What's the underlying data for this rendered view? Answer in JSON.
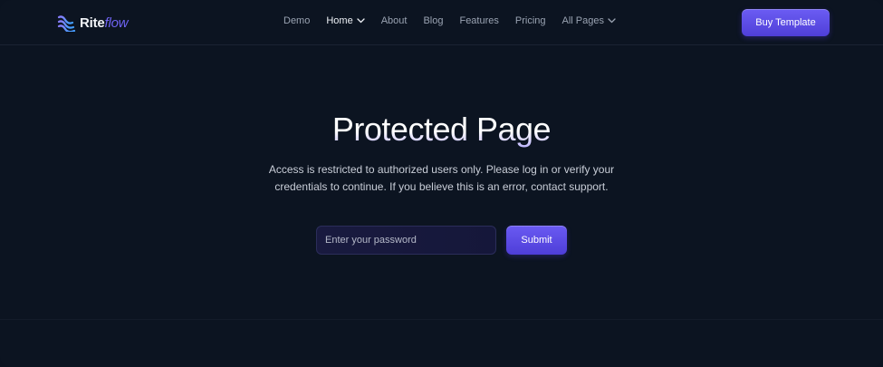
{
  "brand": {
    "name_main": "Rite",
    "name_accent": "flow",
    "accent_color": "#6e63f2"
  },
  "nav": {
    "items": [
      {
        "label": "Demo",
        "dropdown": false,
        "active": false
      },
      {
        "label": "Home",
        "dropdown": true,
        "active": true
      },
      {
        "label": "About",
        "dropdown": false,
        "active": false
      },
      {
        "label": "Blog",
        "dropdown": false,
        "active": false
      },
      {
        "label": "Features",
        "dropdown": false,
        "active": false
      },
      {
        "label": "Pricing",
        "dropdown": false,
        "active": false
      },
      {
        "label": "All Pages",
        "dropdown": true,
        "active": false
      }
    ],
    "cta_label": "Buy Template"
  },
  "hero": {
    "title": "Protected Page",
    "description_line1": "Access is restricted to authorized users only. Please log in or verify your",
    "description_line2": "credentials to continue. If you believe this is an error, contact support."
  },
  "form": {
    "password_placeholder": "Enter your password",
    "password_value": "",
    "submit_label": "Submit"
  },
  "colors": {
    "background": "#0c1421",
    "button": "#5b4be6",
    "input_background": "#181a3e"
  },
  "icons": {
    "logo": "riteflow-logo-mark",
    "dropdown": "chevron-down-icon"
  }
}
